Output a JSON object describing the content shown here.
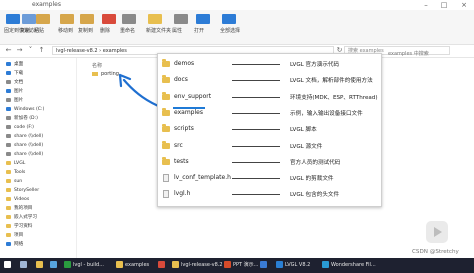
{
  "window": {
    "title": "examples"
  },
  "ribbon": {
    "items": [
      {
        "label": "固定到快速访问",
        "color": "#2d7cd6"
      },
      {
        "label": "复制",
        "color": "#6b9bd8"
      },
      {
        "label": "粘贴",
        "color": "#d6a64b"
      },
      {
        "label": "移动到",
        "color": "#d6a64b"
      },
      {
        "label": "复制到",
        "color": "#d6a64b"
      },
      {
        "label": "删除",
        "color": "#d94a3b"
      },
      {
        "label": "重命名",
        "color": "#8a8a8a"
      },
      {
        "label": "新建文件夹",
        "color": "#e8bf4f"
      },
      {
        "label": "属性",
        "color": "#8a8a8a"
      },
      {
        "label": "打开",
        "color": "#2d7cd6"
      },
      {
        "label": "全部选择",
        "color": "#2d7cd6"
      }
    ]
  },
  "address": {
    "path": "lvgl-release-v8.2 › examples",
    "search_placeholder": "搜索 examples"
  },
  "sidebar": {
    "items": [
      {
        "label": "桌面",
        "color": "#2d7cd6"
      },
      {
        "label": "下载",
        "color": "#2d7cd6"
      },
      {
        "label": "文档",
        "color": "#8a8a8a"
      },
      {
        "label": "图片",
        "color": "#2d7cd6"
      },
      {
        "label": "图片",
        "color": "#8a8a8a"
      },
      {
        "label": "Windows (C:)",
        "color": "#2d7cd6"
      },
      {
        "label": "新加卷 (D:)",
        "color": "#8a8a8a"
      },
      {
        "label": "code (F:)",
        "color": "#8a8a8a"
      },
      {
        "label": "share (\\\\dell)",
        "color": "#8a8a8a"
      },
      {
        "label": "share (\\\\dell)",
        "color": "#8a8a8a"
      },
      {
        "label": "share (\\\\dell)",
        "color": "#8a8a8a"
      },
      {
        "label": "LVGL",
        "color": "#e8bf4f"
      },
      {
        "label": "Tools",
        "color": "#e8bf4f"
      },
      {
        "label": "sun",
        "color": "#e8bf4f"
      },
      {
        "label": "StorySeller",
        "color": "#e8bf4f"
      },
      {
        "label": "Videos",
        "color": "#e8bf4f"
      },
      {
        "label": "我的项目",
        "color": "#e8bf4f"
      },
      {
        "label": "嵌入式学习",
        "color": "#e8bf4f"
      },
      {
        "label": "学习资料",
        "color": "#e8bf4f"
      },
      {
        "label": "项目",
        "color": "#e8bf4f"
      },
      {
        "label": "网络",
        "color": "#2d7cd6"
      }
    ]
  },
  "main": {
    "column_header": "名称",
    "item": "porting"
  },
  "right_header": "examples 中搜索",
  "popup": {
    "rows": [
      {
        "name": "demos",
        "desc": "LVGL 官方演示代码",
        "type": "folder"
      },
      {
        "name": "docs",
        "desc": "LVGL 文档，解析部件的使用方法",
        "type": "folder"
      },
      {
        "name": "env_support",
        "desc": "环境支持(MDK、ESP、RTThread)",
        "type": "folder"
      },
      {
        "name": "examples",
        "desc": "示例，输入输出设备接口文件",
        "type": "folder"
      },
      {
        "name": "scripts",
        "desc": "LVGL 脚本",
        "type": "folder"
      },
      {
        "name": "src",
        "desc": "LVGL 源文件",
        "type": "folder"
      },
      {
        "name": "tests",
        "desc": "官方人员的测试代码",
        "type": "folder"
      },
      {
        "name": "lv_conf_template.h",
        "desc": "LVGL 的剪裁文件",
        "type": "file"
      },
      {
        "name": "lvgl.h",
        "desc": "LVGL 包含的头文件",
        "type": "file"
      }
    ]
  },
  "taskbar": {
    "items": [
      {
        "label": "",
        "color": "#ffffff"
      },
      {
        "label": "",
        "color": "#9fb5d6"
      },
      {
        "label": "",
        "color": "#e8bf4f"
      },
      {
        "label": "",
        "color": "#58a5e0"
      },
      {
        "label": "lvgl - build...",
        "color": "#2a9d3f"
      },
      {
        "label": "examples",
        "color": "#e8bf4f"
      },
      {
        "label": "",
        "color": "#d94a3b"
      },
      {
        "label": "lvgl-release-v8.2",
        "color": "#e8bf4f"
      },
      {
        "label": "PPT 演示...",
        "color": "#d64b2a"
      },
      {
        "label": "",
        "color": "#3a7bd5"
      },
      {
        "label": "LVGL V8.2",
        "color": "#2a7fd4"
      },
      {
        "label": "Wondershare Fil...",
        "color": "#2a9bd4"
      }
    ]
  },
  "watermark": "CSDN @Stretchy",
  "colors": {
    "accent": "#1f7ad6",
    "folder": "#e8bf4f",
    "taskbar": "#1e2130"
  }
}
